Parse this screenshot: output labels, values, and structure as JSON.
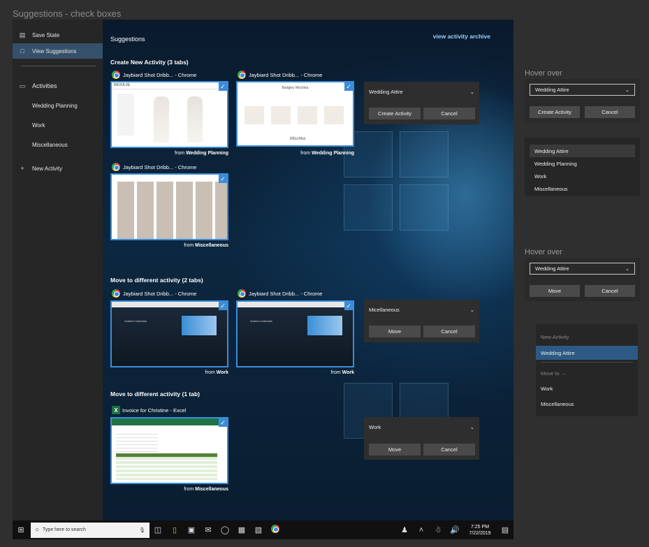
{
  "canvas_title": "Suggestions - check boxes",
  "sidebar": {
    "save_state": "Save State",
    "view_suggestions": "View Suggestions",
    "activities_header": "Activities",
    "activities": [
      "Wedding Planning",
      "Work",
      "Miscellaneous"
    ],
    "new_activity": "New Activity"
  },
  "main": {
    "title": "Suggestions",
    "archive_link": "view activity archive",
    "sections": [
      {
        "title": "Create New Activity (3 tabs)"
      },
      {
        "title": "Move to different activity (2 tabs)"
      },
      {
        "title": "Move to different activity (1 tab)"
      }
    ],
    "tabs": [
      {
        "title": "Jaybiard Shot Dribb... - Chrome",
        "from_prefix": "from",
        "from": "Wedding Planning"
      },
      {
        "title": "Jaybiard Shot Dribb... - Chrome",
        "from_prefix": "from",
        "from": "Wedding Planning"
      },
      {
        "title": "Jaybiard Shot Dribb... - Chrome",
        "from_prefix": "from",
        "from": "Miscellaneous"
      },
      {
        "title": "Jaybiard Shot Dribb... - Chrome",
        "from_prefix": "from",
        "from": "Work"
      },
      {
        "title": "Jaybiard Shot Dribb... - Chrome",
        "from_prefix": "from",
        "from": "Work"
      },
      {
        "title": "Invoice for Christine - Excel",
        "from_prefix": "from",
        "from": "Miscellaneous"
      }
    ],
    "thumb_texts": {
      "shop_header": "REVOLVE",
      "bridal_header": "Badgley Mischka",
      "bridal_script": "Mischka",
      "desktop_caption": "Ambient materials"
    },
    "panels": [
      {
        "dropdown": "Wedding Attire",
        "primary": "Create Activity",
        "secondary": "Cancel"
      },
      {
        "dropdown": "Micellaneous",
        "primary": "Move",
        "secondary": "Cancel"
      },
      {
        "dropdown": "Work",
        "primary": "Move",
        "secondary": "Cancel"
      }
    ]
  },
  "annotations": {
    "hover1_label": "Hover over",
    "hover1": {
      "dropdown": "Wedding Attire",
      "primary": "Create Activity",
      "secondary": "Cancel"
    },
    "dropdown_list": [
      "Wedding Attire",
      "Wedding Planning",
      "Work",
      "Miscellaneous"
    ],
    "hover2_label": "Hover over",
    "hover2": {
      "dropdown": "Wedding Attire",
      "primary": "Move",
      "secondary": "Cancel"
    },
    "menu": {
      "new_activity_header": "New Activity",
      "highlighted": "Wedding Attire",
      "move_to_header": "Move to →",
      "items": [
        "Work",
        "Miscellaneous"
      ]
    }
  },
  "taskbar": {
    "search_placeholder": "Type here to search",
    "time": "7:25 PM",
    "date": "7/22/2019"
  },
  "colors": {
    "accent": "#3b8dd9",
    "selected": "#35506a",
    "link": "#9ad0ff"
  }
}
